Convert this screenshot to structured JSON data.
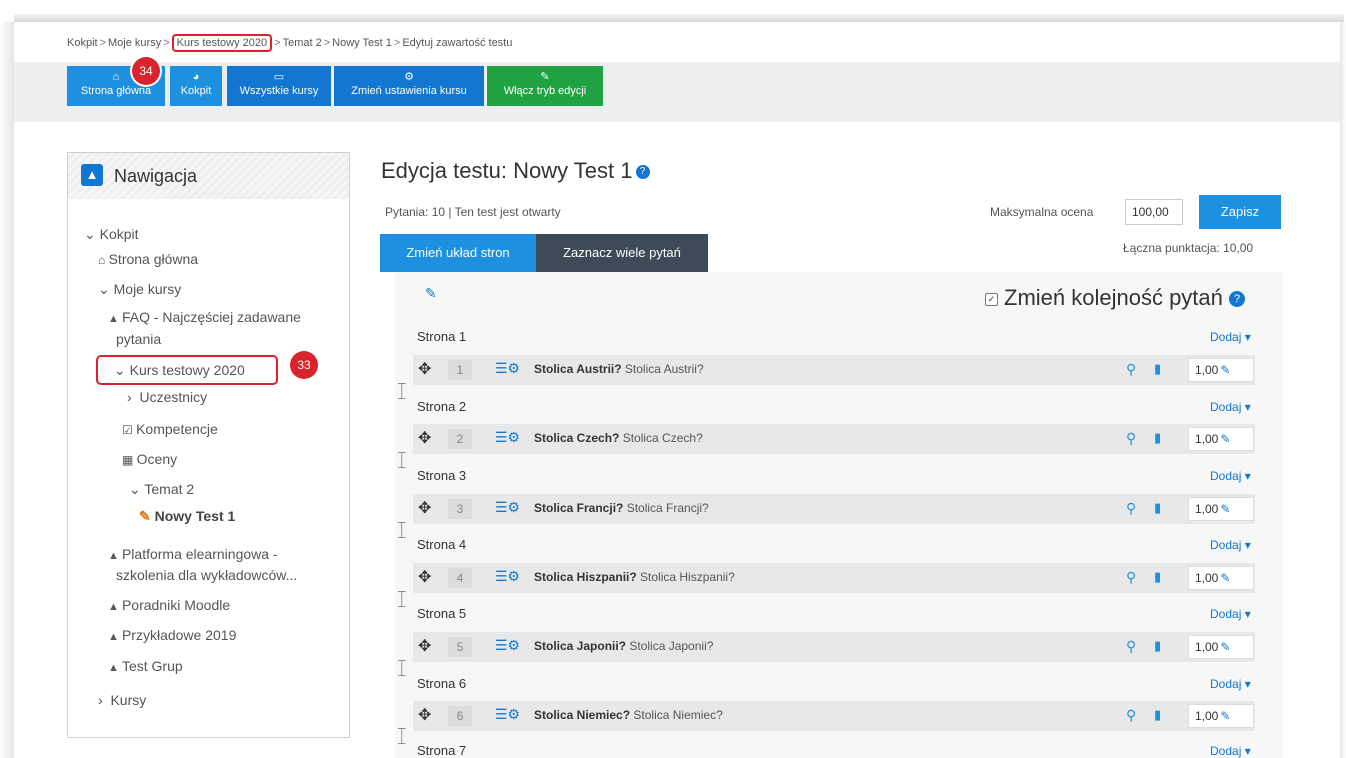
{
  "breadcrumb": {
    "items": [
      "Kokpit",
      "Moje kursy",
      "Kurs testowy 2020",
      "Temat 2",
      "Nowy Test 1",
      "Edytuj zawartość testu"
    ],
    "separator": ">"
  },
  "navbar": {
    "buttons": [
      {
        "label": "Strona główna",
        "icon": "home-icon",
        "color": "#1e90e0"
      },
      {
        "label": "Kokpit",
        "icon": "dashboard-icon",
        "color": "#1e90e0"
      },
      {
        "label": "Wszystkie kursy",
        "icon": "book-icon",
        "color": "#1177d1"
      },
      {
        "label": "Zmień ustawienia kursu",
        "icon": "gear-icon",
        "color": "#1177d1"
      },
      {
        "label": "Włącz tryb edycji",
        "icon": "edit-icon",
        "color": "#1fa343"
      }
    ]
  },
  "annotations": {
    "badge_34": "34",
    "badge_33": "33",
    "color": "#d9232d"
  },
  "navigation": {
    "title": "Nawigacja",
    "items": [
      {
        "label": "Kokpit",
        "icon": "chevron-down-icon"
      },
      {
        "label": "Strona główna",
        "icon": "home-icon"
      },
      {
        "label": "Moje kursy",
        "icon": "chevron-down-icon"
      },
      {
        "label": "FAQ - Najczęściej zadawane",
        "icon": "graduation-cap-icon"
      },
      {
        "label": "pytania"
      },
      {
        "label": "Kurs testowy 2020",
        "icon": "chevron-down-icon"
      },
      {
        "label": "Uczestnicy",
        "icon": "chevron-right-icon"
      },
      {
        "label": "Kompetencje",
        "icon": "checkbox-icon"
      },
      {
        "label": "Oceny",
        "icon": "table-icon"
      },
      {
        "label": "Temat 2",
        "icon": "chevron-down-icon"
      },
      {
        "label": "Nowy Test 1",
        "icon": "quiz-icon"
      },
      {
        "label": "Platforma elearningowa -",
        "icon": "graduation-cap-icon"
      },
      {
        "label": "szkolenia dla wykładowców..."
      },
      {
        "label": "Poradniki Moodle",
        "icon": "graduation-cap-icon"
      },
      {
        "label": "Przykładowe 2019",
        "icon": "graduation-cap-icon"
      },
      {
        "label": "Test Grup",
        "icon": "graduation-cap-icon"
      },
      {
        "label": "Kursy",
        "icon": "chevron-right-icon"
      }
    ]
  },
  "main": {
    "title": "Edycja testu: Nowy Test 1",
    "status": "Pytania: 10 | Ten test jest otwarty",
    "max_grade_label": "Maksymalna ocena",
    "max_grade_value": "100,00",
    "save_label": "Zapisz",
    "total_label": "Łączna punktacja: 10,00",
    "tab_repaginate": "Zmień układ stron",
    "tab_select_multiple": "Zaznacz wiele pytań",
    "reorder_label": "Zmień kolejność pytań",
    "add_label": "Dodaj",
    "pages": [
      {
        "label": "Strona 1",
        "question": {
          "num": "1",
          "name": "Stolica Austrii?",
          "text": "Stolica Austrii?",
          "mark": "1,00"
        }
      },
      {
        "label": "Strona 2",
        "question": {
          "num": "2",
          "name": "Stolica Czech?",
          "text": "Stolica Czech?",
          "mark": "1,00"
        }
      },
      {
        "label": "Strona 3",
        "question": {
          "num": "3",
          "name": "Stolica Francji?",
          "text": "Stolica Francji?",
          "mark": "1,00"
        }
      },
      {
        "label": "Strona 4",
        "question": {
          "num": "4",
          "name": "Stolica Hiszpanii?",
          "text": "Stolica Hiszpanii?",
          "mark": "1,00"
        }
      },
      {
        "label": "Strona 5",
        "question": {
          "num": "5",
          "name": "Stolica Japonii?",
          "text": "Stolica Japonii?",
          "mark": "1,00"
        }
      },
      {
        "label": "Strona 6",
        "question": {
          "num": "6",
          "name": "Stolica Niemiec?",
          "text": "Stolica Niemiec?",
          "mark": "1,00"
        }
      },
      {
        "label": "Strona 7"
      }
    ]
  }
}
